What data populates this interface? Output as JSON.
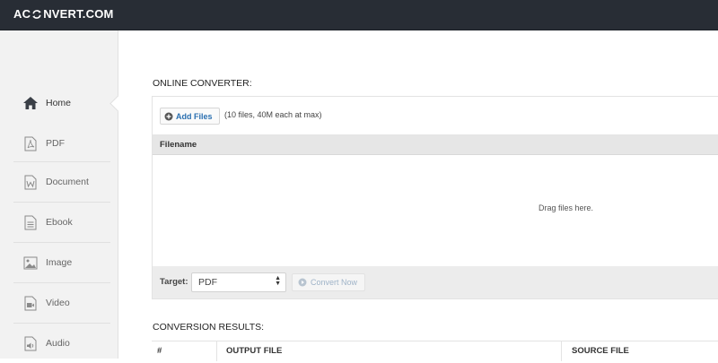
{
  "header": {
    "logo_left": "AC",
    "logo_right": "NVERT.COM",
    "logo_icon": "refresh-icon"
  },
  "sidebar": {
    "items": [
      {
        "label": "Home",
        "icon": "home-icon",
        "active": true
      },
      {
        "label": "PDF",
        "icon": "pdf-file-icon"
      },
      {
        "label": "Document",
        "icon": "word-file-icon"
      },
      {
        "label": "Ebook",
        "icon": "ebook-file-icon"
      },
      {
        "label": "Image",
        "icon": "image-file-icon"
      },
      {
        "label": "Video",
        "icon": "video-file-icon"
      },
      {
        "label": "Audio",
        "icon": "audio-file-icon"
      }
    ]
  },
  "converter": {
    "title": "ONLINE CONVERTER:",
    "add_files_label": "Add Files",
    "limit_note": "(10 files, 40M each at max)",
    "filename_header": "Filename",
    "drop_text": "Drag files here.",
    "target_label": "Target:",
    "target_value": "PDF",
    "convert_label": "Convert Now"
  },
  "results": {
    "title": "CONVERSION RESULTS:",
    "columns": [
      "#",
      "OUTPUT FILE",
      "SOURCE FILE"
    ]
  }
}
